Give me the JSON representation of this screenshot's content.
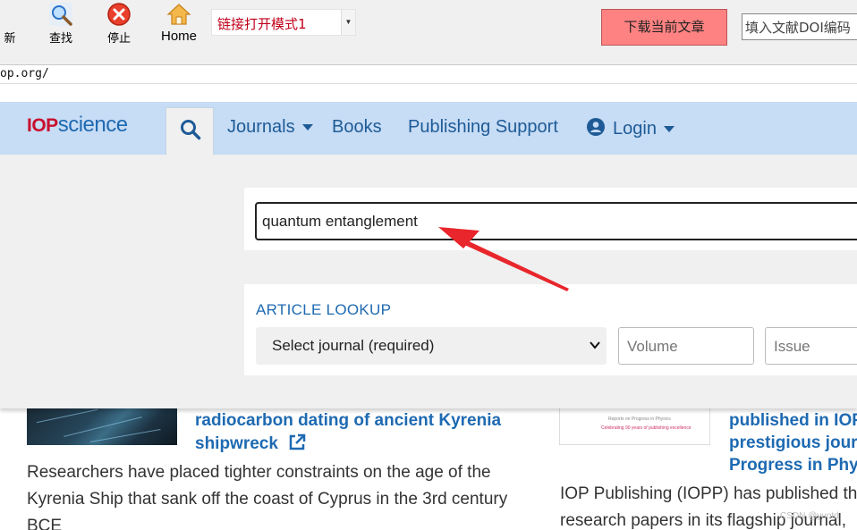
{
  "toolbar": {
    "refresh_label": "新",
    "find_label": "查找",
    "stop_label": "停止",
    "home_label": "Home",
    "mode_select_value": "链接打开模式1",
    "download_label": "下载当前文章",
    "doi_placeholder": "填入文献DOI编码"
  },
  "address_bar": {
    "url_fragment": "op.org/"
  },
  "site": {
    "logo_iop": "IOP",
    "logo_science": "science",
    "nav": {
      "journals": "Journals",
      "books": "Books",
      "publishing_support": "Publishing Support",
      "login": "Login"
    }
  },
  "search": {
    "query": "quantum entanglement"
  },
  "article_lookup": {
    "title": "ARTICLE LOOKUP",
    "journal_select": "Select journal (required)",
    "volume_placeholder": "Volume",
    "issue_placeholder": "Issue"
  },
  "news": {
    "left_link_line1": "radiocarbon dating of ancient Kyrenia",
    "left_link_line2": "shipwreck",
    "left_text": "Researchers have placed tighter constraints on the age of the Kyrenia Ship that sank off the coast of Cyprus in the 3rd century BCE",
    "right_thumb_line1": "Reports on Progress in Physics",
    "right_thumb_line2": "Celebrating 90 years of publishing excellence",
    "right_link_line1": "published in IOP",
    "right_link_line2": "prestigious jour",
    "right_link_line3": "Progress in Phys",
    "right_text_line1": "IOP Publishing (IOPP) has published th",
    "right_text_line2": "research papers in its flagship journal,"
  },
  "watermark": "CSDN @yuntd",
  "colors": {
    "header_bg": "#c7dcf5",
    "link_blue": "#1e6ab2",
    "logo_red": "#c8102e",
    "download_button": "#ff8282",
    "annotation_red": "#e8262b"
  }
}
